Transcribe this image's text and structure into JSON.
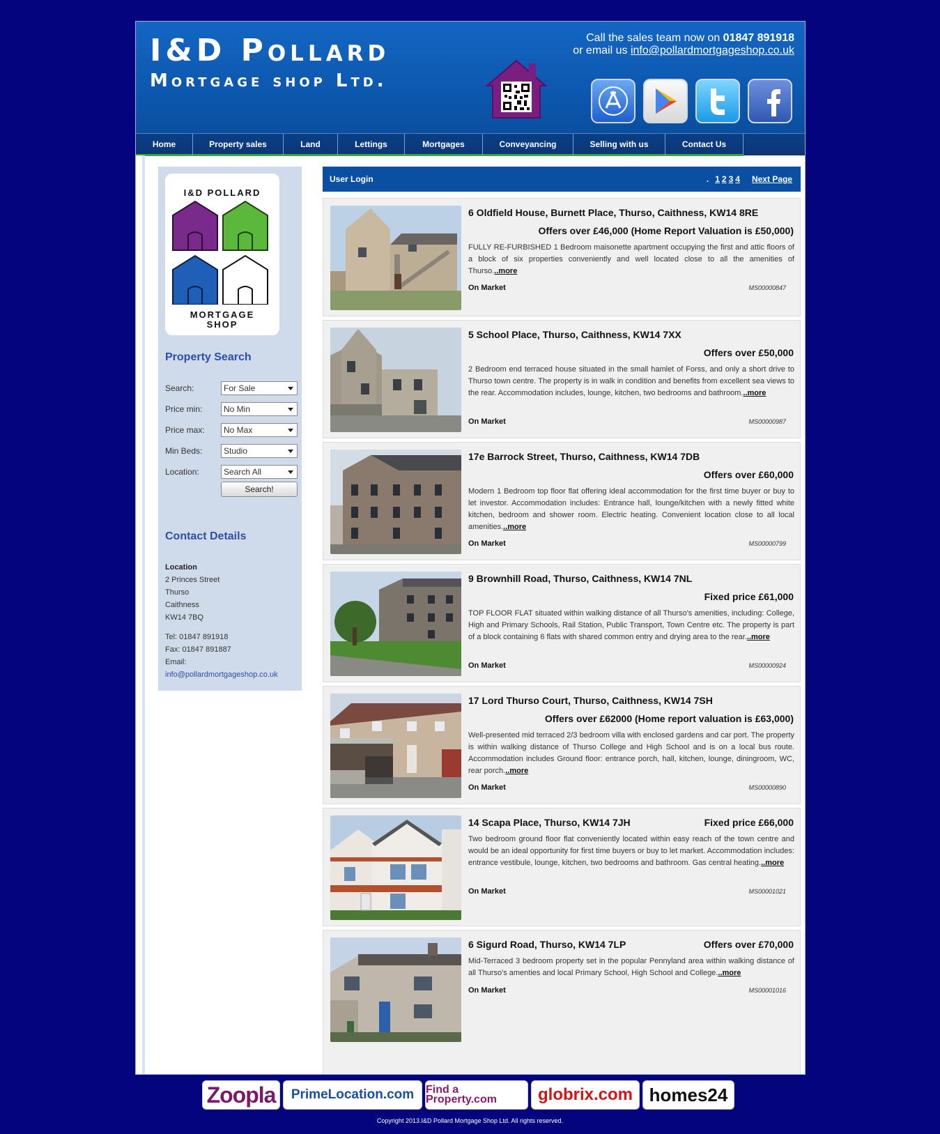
{
  "header": {
    "brand_line1": "I&D Pollard",
    "brand_line2": "Mortgage shop Ltd.",
    "call_prefix": "Call the sales team now on ",
    "phone": "01847 891918",
    "email_prefix": "or email us ",
    "email": "info@pollardmortgageshop.co.uk"
  },
  "nav": {
    "items": [
      {
        "label": "Home"
      },
      {
        "label": "Property sales"
      },
      {
        "label": "Land"
      },
      {
        "label": "Lettings"
      },
      {
        "label": "Mortgages"
      },
      {
        "label": "Conveyancing"
      },
      {
        "label": "Selling with us"
      },
      {
        "label": "Contact Us"
      }
    ]
  },
  "sidebar": {
    "logo_title": "I&D POLLARD",
    "logo_sub1": "MORTGAGE",
    "logo_sub2": "SHOP",
    "search_heading": "Property Search",
    "fields": [
      {
        "label": "Search:",
        "value": "For Sale"
      },
      {
        "label": "Price min:",
        "value": "No Min"
      },
      {
        "label": "Price max:",
        "value": "No Max"
      },
      {
        "label": "Min Beds:",
        "value": "Studio"
      },
      {
        "label": "Location:",
        "value": "Search All"
      }
    ],
    "search_button": "Search!",
    "contact_heading": "Contact Details",
    "location_heading": "Location",
    "address": [
      "2 Princes Street",
      "Thurso",
      "Caithness",
      "KW14 7BQ"
    ],
    "tel": "Tel: 01847 891918",
    "fax": "Fax: 01847 891887",
    "email_label": "Email:",
    "email": "info@pollardmortgageshop.co.uk"
  },
  "listbar": {
    "user_login": "User Login",
    "dot": ".",
    "pages": [
      "1",
      "2",
      "3",
      "4"
    ],
    "next": "Next Page"
  },
  "listings": [
    {
      "address": "6 Oldfield House, Burnett Place, Thurso, Caithness, KW14 8RE",
      "price": "Offers over £46,000 (Home Report Valuation is £50,000)",
      "description": "FULLY RE-FURBISHED 1 Bedroom maisonette apartment occupying the first and attic floors of a block of six properties conveniently and well located close to all the amenities of Thurso.",
      "more": "..more",
      "status": "On Market",
      "ref": "MS00000847"
    },
    {
      "address": "5 School Place, Thurso, Caithness, KW14 7XX",
      "price": "Offers over £50,000",
      "description": "2 Bedroom end terraced house situated in the small hamlet of Forss, and only a short drive to Thurso town centre. The property is in walk in condition and benefits from excellent sea views to the rear. Accommodation includes, lounge, kitchen, two bedrooms and bathroom.",
      "more": "..more",
      "status": "On Market",
      "ref": "MS00000987"
    },
    {
      "address": "17e Barrock Street, Thurso, Caithness, KW14 7DB",
      "price": "Offers over £60,000",
      "description": "Modern 1 Bedroom top floor flat offering ideal accommodation for the first time buyer or buy to let investor. Accommodation includes: Entrance hall, lounge/kitchen with a newly fitted white kitchen, bedroom and shower room. Electric heating. Convenient location close to all local amenities.",
      "more": "..more",
      "status": "On Market",
      "ref": "MS00000799"
    },
    {
      "address": "9 Brownhill Road, Thurso, Caithness, KW14 7NL",
      "price": "Fixed price £61,000",
      "description": "TOP FLOOR FLAT situated within walking distance of all Thurso's amenities, including: College, High and Primary Schools, Rail Station, Public Transport, Town Centre etc. The property is part of a block containing 6 flats with shared common entry and drying area to the rear.",
      "more": "..more",
      "status": "On Market",
      "ref": "MS00000924"
    },
    {
      "address": "17 Lord Thurso Court, Thurso, Caithness, KW14 7SH",
      "price": "Offers over £62000 (Home report valuation is £63,000)",
      "description": "Well-presented mid terraced 2/3 bedroom villa with enclosed gardens and car port. The property is within walking distance of Thurso College and High School and is on a local bus route. Accommodation includes Ground floor: entrance porch, hall, kitchen, lounge, diningroom, WC, rear porch.",
      "more": "..more",
      "status": "On Market",
      "ref": "MS00000890"
    },
    {
      "address": "14 Scapa Place, Thurso, KW14 7JH",
      "price": "Fixed price £66,000",
      "description": "Two bedroom ground floor flat conveniently located within easy reach of the town centre and would be an ideal opportunity for first time buyers or buy to let market. Accommodation includes: entrance vestibule, lounge, kitchen, two bedrooms and bathroom. Gas central heating.",
      "more": "..more",
      "status": "On Market",
      "ref": "MS00001021"
    },
    {
      "address": "6 Sigurd Road, Thurso, KW14 7LP",
      "price": "Offers over £70,000",
      "description": "Mid-Terraced 3 bedroom property set in the popular Pennyland area within walking distance of all Thurso's amenties and local Primary School, High School and College.",
      "more": "..more",
      "status": "On Market",
      "ref": "MS00001016"
    }
  ],
  "partners": [
    "Zoopla",
    "PrimeLocation.com",
    "Find a Property.com",
    "globrix.com",
    "homes24"
  ],
  "copyright": "Copyright 2013.I&D Pollard Mortgage Shop Ltd. All rights reserved."
}
